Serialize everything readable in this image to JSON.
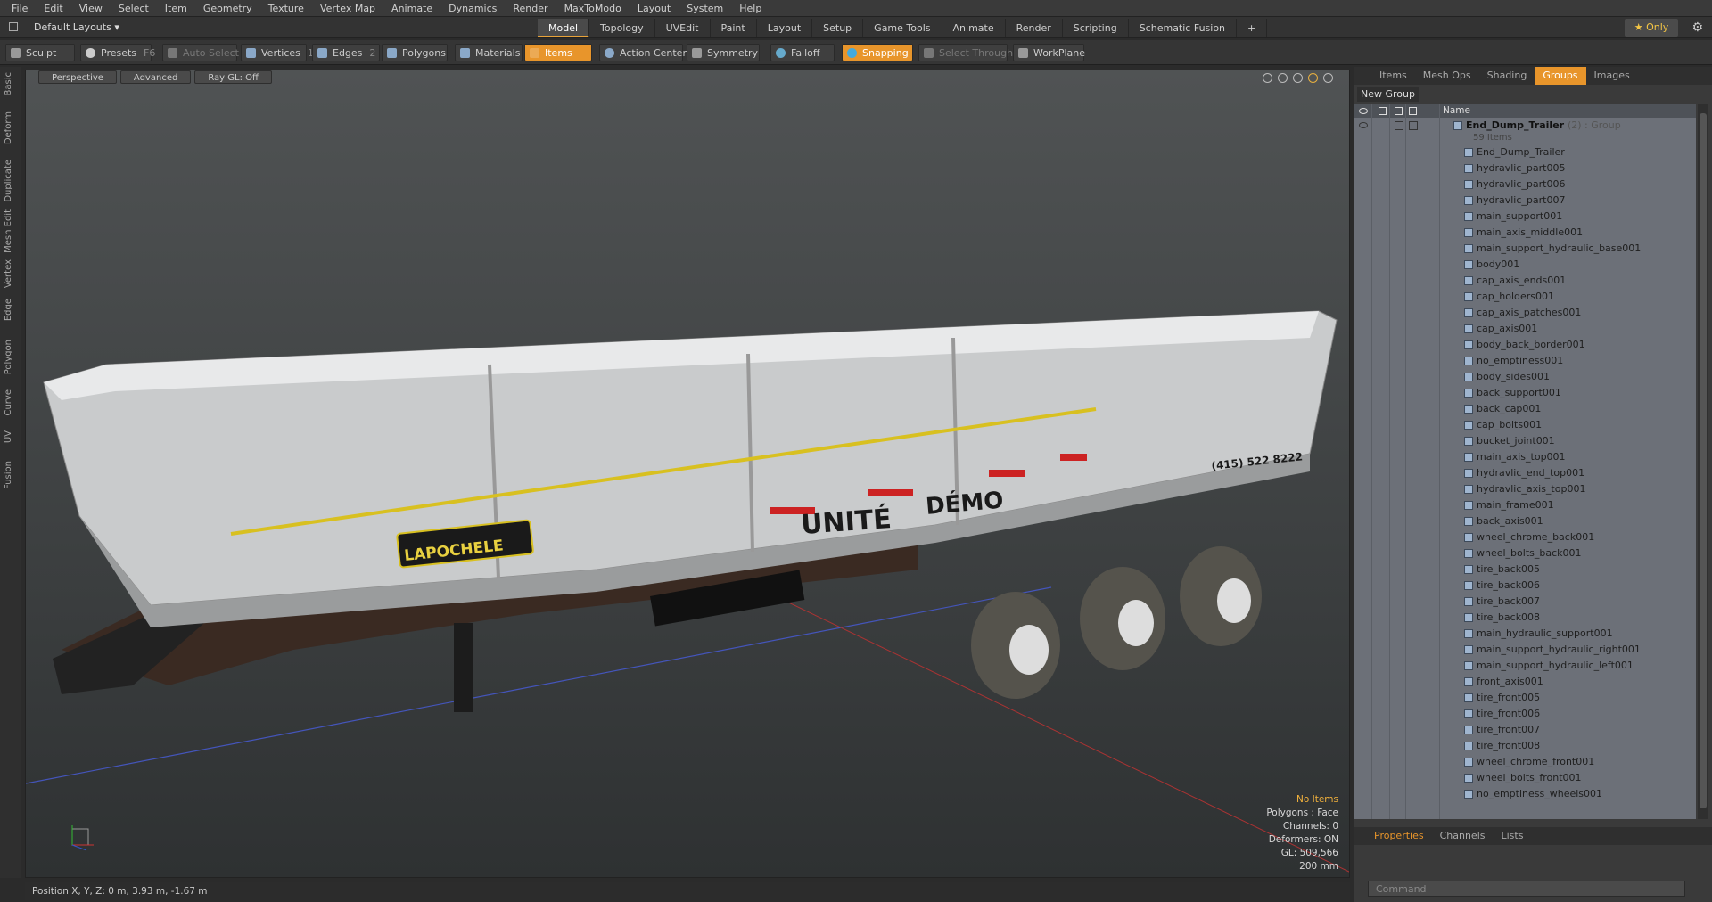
{
  "menu": [
    "File",
    "Edit",
    "View",
    "Select",
    "Item",
    "Geometry",
    "Texture",
    "Vertex Map",
    "Animate",
    "Dynamics",
    "Render",
    "MaxToModo",
    "Layout",
    "System",
    "Help"
  ],
  "layout_dropdown": "Default Layouts",
  "mode_tabs": [
    {
      "label": "Model",
      "active": true
    },
    {
      "label": "Topology"
    },
    {
      "label": "UVEdit"
    },
    {
      "label": "Paint"
    },
    {
      "label": "Layout"
    },
    {
      "label": "Setup"
    },
    {
      "label": "Game Tools"
    },
    {
      "label": "Animate"
    },
    {
      "label": "Render"
    },
    {
      "label": "Scripting"
    },
    {
      "label": "Schematic Fusion"
    }
  ],
  "only_label": "Only",
  "toolbar": {
    "sculpt": "Sculpt",
    "presets": "Presets",
    "presets_key": "F6",
    "auto_select": "Auto Select",
    "vertices": "Vertices",
    "vertices_count": "1",
    "edges": "Edges",
    "edges_count": "2",
    "polygons": "Polygons",
    "materials": "Materials",
    "items": "Items",
    "action_center": "Action Center",
    "symmetry": "Symmetry",
    "falloff": "Falloff",
    "snapping": "Snapping",
    "select_through": "Select Through",
    "workplane": "WorkPlane"
  },
  "left_tabs": [
    "Basic",
    "Deform",
    "Duplicate",
    "Mesh Edit",
    "Vertex",
    "Edge",
    "Polygon",
    "Curve",
    "UV",
    "Fusion"
  ],
  "viewport": {
    "view": "Perspective",
    "advanced": "Advanced",
    "raygl": "Ray GL: Off",
    "trailer_brand": "LAPOCHELE",
    "trailer_text1": "UNITÉ",
    "trailer_text2": "DÉMO",
    "trailer_phone": "(415) 522 8222",
    "info": {
      "selection": "No Items",
      "polygons": "Polygons : Face",
      "channels": "Channels: 0",
      "deformers": "Deformers: ON",
      "gl": "GL: 509,566",
      "scale": "200 mm"
    }
  },
  "status": "Position X, Y, Z:   0 m, 3.93 m, -1.67 m",
  "right_tabs": [
    {
      "label": "Items"
    },
    {
      "label": "Mesh Ops"
    },
    {
      "label": "Shading"
    },
    {
      "label": "Groups",
      "active": true
    },
    {
      "label": "Images"
    }
  ],
  "new_group": "New Group",
  "list_header_name": "Name",
  "group": {
    "name": "End_Dump_Trailer",
    "count": "(2)",
    "type": ": Group",
    "items": "59 Items"
  },
  "items": [
    "End_Dump_Trailer",
    "hydravlic_part005",
    "hydravlic_part006",
    "hydravlic_part007",
    "main_support001",
    "main_axis_middle001",
    "main_support_hydraulic_base001",
    "body001",
    "cap_axis_ends001",
    "cap_holders001",
    "cap_axis_patches001",
    "cap_axis001",
    "body_back_border001",
    "no_emptiness001",
    "body_sides001",
    "back_support001",
    "back_cap001",
    "cap_bolts001",
    "bucket_joint001",
    "main_axis_top001",
    "hydravlic_end_top001",
    "hydravlic_axis_top001",
    "main_frame001",
    "back_axis001",
    "wheel_chrome_back001",
    "wheel_bolts_back001",
    "tire_back005",
    "tire_back006",
    "tire_back007",
    "tire_back008",
    "main_hydraulic_support001",
    "main_support_hydraulic_right001",
    "main_support_hydraulic_left001",
    "front_axis001",
    "tire_front005",
    "tire_front006",
    "tire_front007",
    "tire_front008",
    "wheel_chrome_front001",
    "wheel_bolts_front001",
    "no_emptiness_wheels001"
  ],
  "bottom_tabs": [
    {
      "label": "Properties",
      "active": true
    },
    {
      "label": "Channels"
    },
    {
      "label": "Lists"
    }
  ],
  "command_placeholder": "Command",
  "colors": {
    "accent": "#e8952b",
    "list_bg": "#6c7078"
  }
}
